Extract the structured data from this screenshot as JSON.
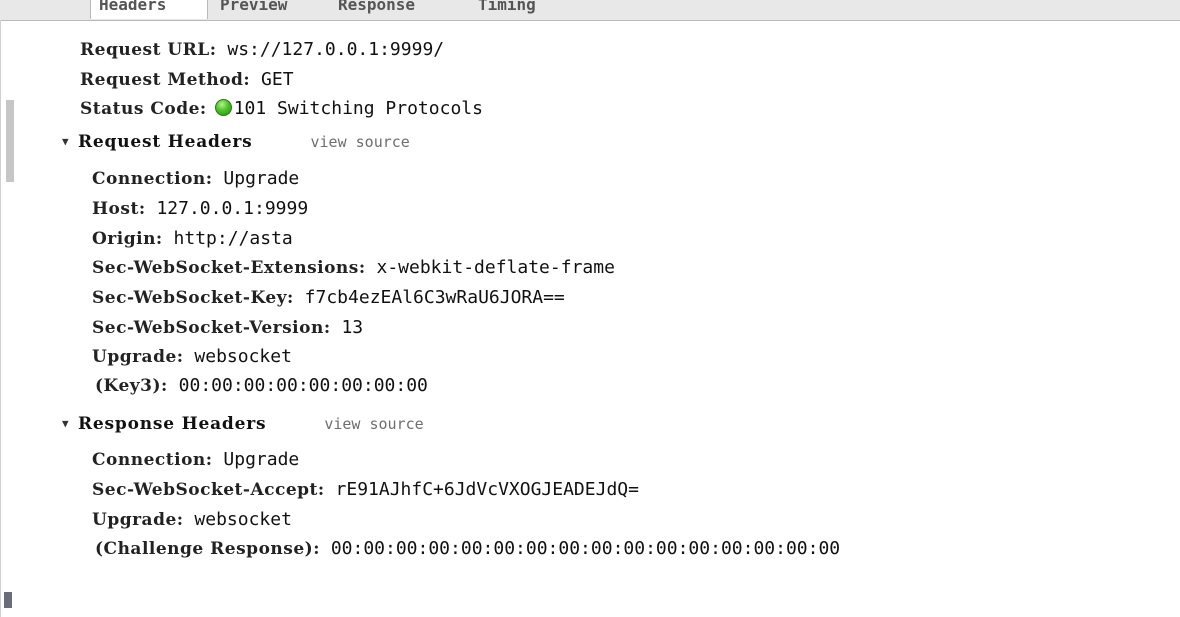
{
  "tabs": [
    {
      "label": "Headers"
    },
    {
      "label": "Preview"
    },
    {
      "label": "Response"
    },
    {
      "label": "Timing"
    }
  ],
  "general": {
    "request_url": {
      "key": "Request URL:",
      "value": "ws://127.0.0.1:9999/"
    },
    "request_method": {
      "key": "Request Method:",
      "value": "GET"
    },
    "status_code": {
      "key": "Status Code:",
      "value": "101 Switching Protocols",
      "status_color": "#4cc12a"
    }
  },
  "request_headers": {
    "title": "Request Headers",
    "view_source": "view source",
    "items": [
      {
        "key": "Connection:",
        "value": "Upgrade"
      },
      {
        "key": "Host:",
        "value": "127.0.0.1:9999"
      },
      {
        "key": "Origin:",
        "value": "http://asta"
      },
      {
        "key": "Sec-WebSocket-Extensions:",
        "value": "x-webkit-deflate-frame"
      },
      {
        "key": "Sec-WebSocket-Key:",
        "value": "f7cb4ezEAl6C3wRaU6JORA=="
      },
      {
        "key": "Sec-WebSocket-Version:",
        "value": "13"
      },
      {
        "key": "Upgrade:",
        "value": "websocket"
      },
      {
        "key": "(Key3):",
        "value": "00:00:00:00:00:00:00:00"
      }
    ]
  },
  "response_headers": {
    "title": "Response Headers",
    "view_source": "view source",
    "items": [
      {
        "key": "Connection:",
        "value": "Upgrade"
      },
      {
        "key": "Sec-WebSocket-Accept:",
        "value": "rE91AJhfC+6JdVcVXOGJEADEJdQ="
      },
      {
        "key": "Upgrade:",
        "value": "websocket"
      },
      {
        "key": "(Challenge Response):",
        "value": "00:00:00:00:00:00:00:00:00:00:00:00:00:00:00:00"
      }
    ]
  }
}
